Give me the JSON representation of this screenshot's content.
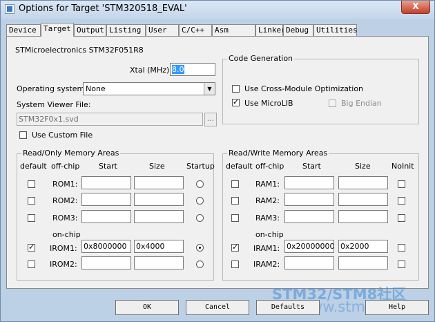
{
  "window": {
    "title": "Options for Target 'STM320518_EVAL'",
    "close_glyph": "X"
  },
  "tabs": [
    "Device",
    "Target",
    "Output",
    "Listing",
    "User",
    "C/C++",
    "Asm",
    "Linker",
    "Debug",
    "Utilities"
  ],
  "active_tab": "Target",
  "device_name": "STMicroelectronics STM32F051R8",
  "xtal": {
    "label": "Xtal (MHz):",
    "value": "8.0"
  },
  "os": {
    "label": "Operating system:",
    "value": "None"
  },
  "svf": {
    "label": "System Viewer File:",
    "value": "STM32F0x1.svd",
    "browse": "..."
  },
  "use_custom_file": {
    "label": "Use Custom File",
    "checked": false
  },
  "code_gen": {
    "title": "Code Generation",
    "cross_module": {
      "label": "Use Cross-Module Optimization",
      "checked": false
    },
    "microlib": {
      "label": "Use MicroLIB",
      "checked": true
    },
    "big_endian": {
      "label": "Big Endian",
      "checked": false
    }
  },
  "rom": {
    "title": "Read/Only Memory Areas",
    "headers": {
      "default": "default",
      "offchip": "off-chip",
      "start": "Start",
      "size": "Size",
      "startup": "Startup"
    },
    "onchip_label": "on-chip",
    "rows": [
      {
        "label": "ROM1:",
        "start": "",
        "size": ""
      },
      {
        "label": "ROM2:",
        "start": "",
        "size": ""
      },
      {
        "label": "ROM3:",
        "start": "",
        "size": ""
      },
      {
        "label": "IROM1:",
        "start": "0x8000000",
        "size": "0x4000"
      },
      {
        "label": "IROM2:",
        "start": "",
        "size": ""
      }
    ]
  },
  "ram": {
    "title": "Read/Write Memory Areas",
    "headers": {
      "default": "default",
      "offchip": "off-chip",
      "start": "Start",
      "size": "Size",
      "noinit": "NoInit"
    },
    "onchip_label": "on-chip",
    "rows": [
      {
        "label": "RAM1:",
        "start": "",
        "size": ""
      },
      {
        "label": "RAM2:",
        "start": "",
        "size": ""
      },
      {
        "label": "RAM3:",
        "start": "",
        "size": ""
      },
      {
        "label": "IRAM1:",
        "start": "0x20000000",
        "size": "0x2000"
      },
      {
        "label": "IRAM2:",
        "start": "",
        "size": ""
      }
    ]
  },
  "buttons": {
    "ok": "OK",
    "cancel": "Cancel",
    "defaults": "Defaults",
    "help": "Help"
  },
  "watermark": {
    "line1": "STM32/STM8社区",
    "line2": "www.stmcu.org"
  }
}
